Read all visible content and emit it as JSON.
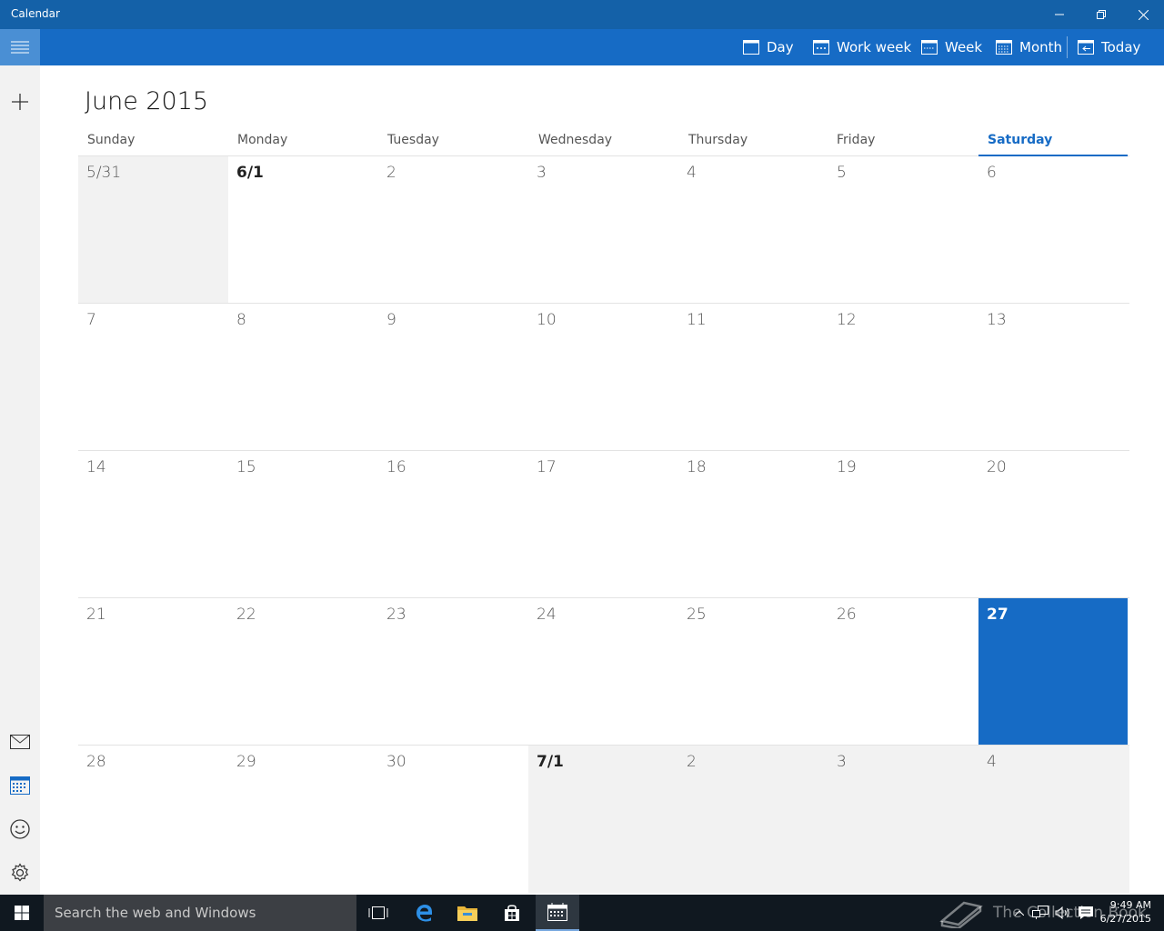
{
  "window": {
    "title": "Calendar"
  },
  "toolbar": {
    "day_label": "Day",
    "work_week_label": "Work week",
    "week_label": "Week",
    "month_label": "Month",
    "today_label": "Today"
  },
  "calendar": {
    "month_title": "June 2015",
    "weekdays": [
      "Sunday",
      "Monday",
      "Tuesday",
      "Wednesday",
      "Thursday",
      "Friday",
      "Saturday"
    ],
    "weeks": [
      [
        "5/31",
        "6/1",
        "2",
        "3",
        "4",
        "5",
        "6"
      ],
      [
        "7",
        "8",
        "9",
        "10",
        "11",
        "12",
        "13"
      ],
      [
        "14",
        "15",
        "16",
        "17",
        "18",
        "19",
        "20"
      ],
      [
        "21",
        "22",
        "23",
        "24",
        "25",
        "26",
        "27"
      ],
      [
        "28",
        "29",
        "30",
        "7/1",
        "2",
        "3",
        "4"
      ]
    ]
  },
  "taskbar": {
    "search_placeholder": "Search the web and Windows",
    "time": "9:49 AM",
    "date": "6/27/2015",
    "watermark": "The Collection Book"
  },
  "colors": {
    "accent": "#166bc5",
    "titlebar": "#1461a8",
    "other_month_bg": "#f2f2f2",
    "taskbar_bg": "#101820"
  }
}
